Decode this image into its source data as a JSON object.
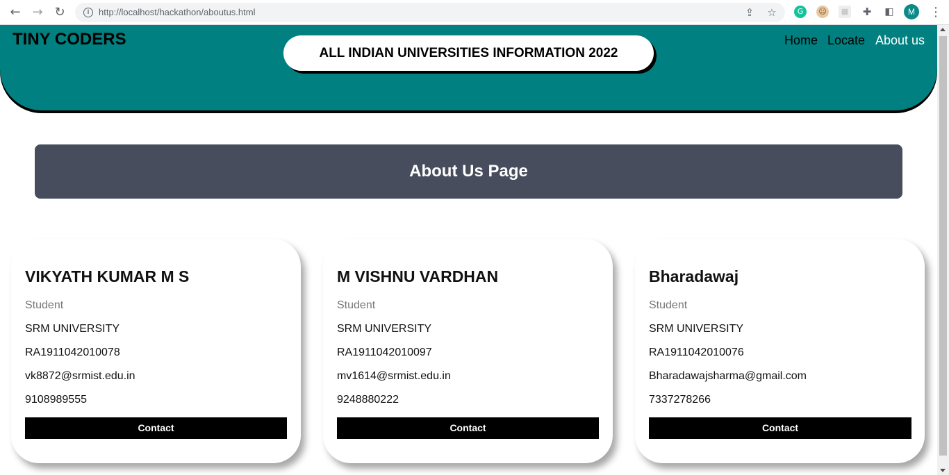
{
  "browser": {
    "url": "http://localhost/hackathon/aboutus.html",
    "profile_initial": "M"
  },
  "header": {
    "brand": "TINY CODERS",
    "banner": "ALL INDIAN UNIVERSITIES INFORMATION 2022",
    "nav": [
      "Home",
      "Locate",
      "About us"
    ],
    "active_nav": "About us"
  },
  "about": {
    "title": "About Us Page"
  },
  "cards": [
    {
      "name": "VIKYATH KUMAR M S",
      "role": "Student",
      "university": "SRM UNIVERSITY",
      "reg_no": "RA1911042010078",
      "email": "vk8872@srmist.edu.in",
      "phone": "9108989555",
      "button": "Contact"
    },
    {
      "name": "M VISHNU VARDHAN",
      "role": "Student",
      "university": "SRM UNIVERSITY",
      "reg_no": "RA1911042010097",
      "email": "mv1614@srmist.edu.in",
      "phone": "9248880222",
      "button": "Contact"
    },
    {
      "name": "Bharadawaj",
      "role": "Student",
      "university": "SRM UNIVERSITY",
      "reg_no": "RA1911042010076",
      "email": "Bharadawajsharma@gmail.com",
      "phone": "7337278266",
      "button": "Contact"
    }
  ],
  "colors": {
    "header_bg": "#008080",
    "about_bg": "#474d5d",
    "button_bg": "#000000"
  }
}
